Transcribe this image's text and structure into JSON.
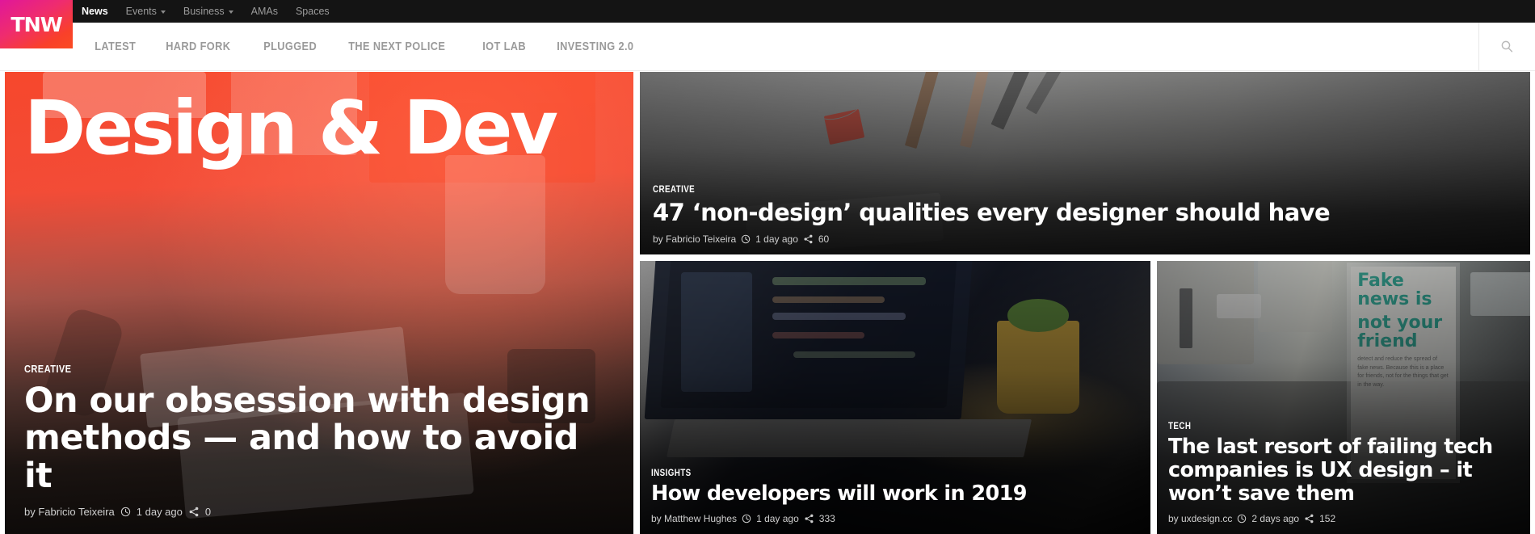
{
  "brand": {
    "logo_text": "TNW",
    "logo_gradient_from": "#e0179a",
    "logo_gradient_to": "#fa4b22"
  },
  "top_nav": {
    "items": [
      {
        "label": "News",
        "active": true,
        "caret": false
      },
      {
        "label": "Events",
        "active": false,
        "caret": true
      },
      {
        "label": "Business",
        "active": false,
        "caret": true
      },
      {
        "label": "AMAs",
        "active": false,
        "caret": false
      },
      {
        "label": "Spaces",
        "active": false,
        "caret": false
      }
    ]
  },
  "sub_nav": {
    "items": [
      {
        "label": "LATEST"
      },
      {
        "label": "HARD FORK"
      },
      {
        "label": "PLUGGED"
      },
      {
        "label": "THE NEXT POLICE"
      },
      {
        "label": "IOT LAB"
      },
      {
        "label": "INVESTING 2.0"
      }
    ],
    "search_icon": "search-icon"
  },
  "hero": {
    "overlay_title": "Design & Dev",
    "kicker": "CREATIVE",
    "headline": "On our obsession with design methods — and how to avoid it",
    "byline": "by Fabricio Teixeira",
    "time_icon": "clock-icon",
    "time": "1 day ago",
    "share_icon": "share-icon",
    "shares": "0"
  },
  "card_top": {
    "kicker": "CREATIVE",
    "headline": "47 ‘non-design’ qualities every designer should have",
    "byline": "by Fabricio Teixeira",
    "time_icon": "clock-icon",
    "time": "1 day ago",
    "share_icon": "share-icon",
    "shares": "60"
  },
  "card_mid": {
    "kicker": "INSIGHTS",
    "headline": "How developers will work in 2019",
    "byline": "by Matthew Hughes",
    "time_icon": "clock-icon",
    "time": "1 day ago",
    "share_icon": "share-icon",
    "shares": "333"
  },
  "card_right": {
    "kicker": "TECH",
    "headline": "The last resort of failing tech companies is UX design – it won’t save them",
    "byline": "by uxdesign.cc",
    "time_icon": "clock-icon",
    "time": "2 days ago",
    "share_icon": "share-icon",
    "shares": "152",
    "poster_line1": "Fake news is",
    "poster_line2": "not your friend",
    "poster_body": "detect and reduce the spread of fake news. Because this is a place for friends, not for the things that get in the way."
  }
}
